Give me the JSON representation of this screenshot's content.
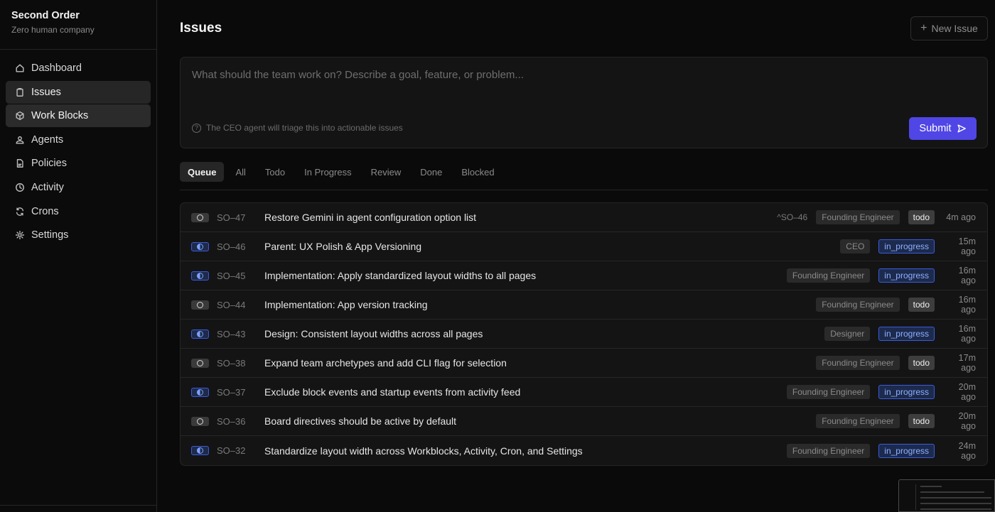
{
  "brand": {
    "name": "Second Order",
    "subtitle": "Zero human company"
  },
  "sidebar": {
    "items": [
      {
        "label": "Dashboard",
        "icon": "home-icon"
      },
      {
        "label": "Issues",
        "icon": "clipboard-icon"
      },
      {
        "label": "Work Blocks",
        "icon": "box-icon"
      },
      {
        "label": "Agents",
        "icon": "agents-icon"
      },
      {
        "label": "Policies",
        "icon": "document-icon"
      },
      {
        "label": "Activity",
        "icon": "clock-icon"
      },
      {
        "label": "Crons",
        "icon": "refresh-icon"
      },
      {
        "label": "Settings",
        "icon": "gear-icon"
      }
    ]
  },
  "header": {
    "title": "Issues",
    "new_issue_label": "New Issue"
  },
  "composer": {
    "placeholder": "What should the team work on? Describe a goal, feature, or problem...",
    "hint": "The CEO agent will triage this into actionable issues",
    "submit_label": "Submit"
  },
  "tabs": [
    "Queue",
    "All",
    "Todo",
    "In Progress",
    "Review",
    "Done",
    "Blocked"
  ],
  "issues": [
    {
      "id": "SO–47",
      "title": "Restore Gemini in agent configuration option list",
      "parent": "^SO–46",
      "assignee": "Founding Engineer",
      "status": "todo",
      "time": "4m ago"
    },
    {
      "id": "SO–46",
      "title": "Parent: UX Polish & App Versioning",
      "parent": "",
      "assignee": "CEO",
      "status": "in_progress",
      "time": "15m ago"
    },
    {
      "id": "SO–45",
      "title": "Implementation: Apply standardized layout widths to all pages",
      "parent": "",
      "assignee": "Founding Engineer",
      "status": "in_progress",
      "time": "16m ago"
    },
    {
      "id": "SO–44",
      "title": "Implementation: App version tracking",
      "parent": "",
      "assignee": "Founding Engineer",
      "status": "todo",
      "time": "16m ago"
    },
    {
      "id": "SO–43",
      "title": "Design: Consistent layout widths across all pages",
      "parent": "",
      "assignee": "Designer",
      "status": "in_progress",
      "time": "16m ago"
    },
    {
      "id": "SO–38",
      "title": "Expand team archetypes and add CLI flag for selection",
      "parent": "",
      "assignee": "Founding Engineer",
      "status": "todo",
      "time": "17m ago"
    },
    {
      "id": "SO–37",
      "title": "Exclude block events and startup events from activity feed",
      "parent": "",
      "assignee": "Founding Engineer",
      "status": "in_progress",
      "time": "20m ago"
    },
    {
      "id": "SO–36",
      "title": "Board directives should be active by default",
      "parent": "",
      "assignee": "Founding Engineer",
      "status": "todo",
      "time": "20m ago"
    },
    {
      "id": "SO–32",
      "title": "Standardize layout width across Workblocks, Activity, Cron, and Settings",
      "parent": "",
      "assignee": "Founding Engineer",
      "status": "in_progress",
      "time": "24m ago"
    }
  ],
  "colors": {
    "accent": "#4f46e5",
    "in_progress": "#8fb0ff",
    "background": "#0a0a0a"
  }
}
